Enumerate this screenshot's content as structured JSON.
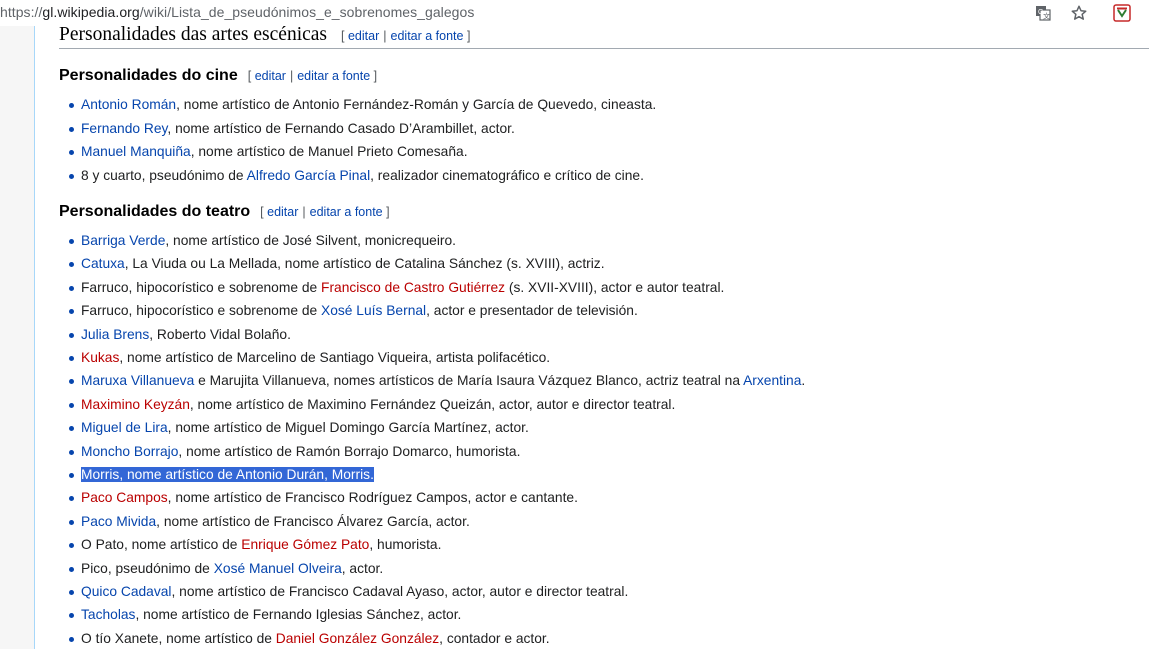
{
  "browser": {
    "url_prefix": "https://",
    "url_host": "gl.wikipedia.org",
    "url_path": "/wiki/Lista_de_pseudónimos_e_sobrenomes_galegos",
    "icons": [
      "translate-icon",
      "star-icon",
      "extension-icon"
    ]
  },
  "edit_labels": {
    "edit": "editar",
    "edit_source": "editar a fonte"
  },
  "heading_top": "Personalidades das artes escénicas",
  "sections": [
    {
      "title": "Personalidades do cine",
      "items": [
        [
          {
            "t": "Antonio Román",
            "c": "blue"
          },
          {
            "t": ", nome artístico de Antonio Fernández-Román y García de Quevedo, cineasta."
          }
        ],
        [
          {
            "t": "Fernando Rey",
            "c": "blue"
          },
          {
            "t": ", nome artístico de Fernando Casado D’Arambillet, actor."
          }
        ],
        [
          {
            "t": "Manuel Manquiña",
            "c": "blue"
          },
          {
            "t": ", nome artístico de Manuel Prieto Comesaña."
          }
        ],
        [
          {
            "t": "8 y cuarto, pseudónimo de "
          },
          {
            "t": "Alfredo García Pinal",
            "c": "blue"
          },
          {
            "t": ", realizador cinematográfico e crítico de cine."
          }
        ]
      ]
    },
    {
      "title": "Personalidades do teatro",
      "items": [
        [
          {
            "t": "Barriga Verde",
            "c": "blue"
          },
          {
            "t": ", nome artístico de José Silvent, monicrequeiro."
          }
        ],
        [
          {
            "t": "Catuxa",
            "c": "blue"
          },
          {
            "t": ", La Viuda ou La Mellada, nome artístico de Catalina Sánchez (s. XVIII), actriz."
          }
        ],
        [
          {
            "t": "Farruco, hipocorístico e sobrenome de "
          },
          {
            "t": "Francisco de Castro Gutiérrez",
            "c": "red"
          },
          {
            "t": " (s. XVII-XVIII), actor e autor teatral."
          }
        ],
        [
          {
            "t": "Farruco, hipocorístico e sobrenome de "
          },
          {
            "t": "Xosé Luís Bernal",
            "c": "blue"
          },
          {
            "t": ", actor e presentador de televisión."
          }
        ],
        [
          {
            "t": "Julia Brens",
            "c": "blue"
          },
          {
            "t": ", Roberto Vidal Bolaño."
          }
        ],
        [
          {
            "t": "Kukas",
            "c": "red"
          },
          {
            "t": ", nome artístico de Marcelino de Santiago Viqueira, artista polifacético."
          }
        ],
        [
          {
            "t": "Maruxa Villanueva",
            "c": "blue"
          },
          {
            "t": " e Marujita Villanueva, nomes artísticos de María Isaura Vázquez Blanco, actriz teatral na "
          },
          {
            "t": "Arxentina",
            "c": "blue"
          },
          {
            "t": "."
          }
        ],
        [
          {
            "t": "Maximino Keyzán",
            "c": "red"
          },
          {
            "t": ", nome artístico de Maximino Fernández Queizán, actor, autor e director teatral."
          }
        ],
        [
          {
            "t": "Miguel de Lira",
            "c": "blue"
          },
          {
            "t": ", nome artístico de Miguel Domingo García Martínez, actor."
          }
        ],
        [
          {
            "t": "Moncho Borrajo",
            "c": "blue"
          },
          {
            "t": ", nome artístico de Ramón Borrajo Domarco, humorista."
          }
        ],
        [
          {
            "t": "Morris, nome artístico de Antonio Durán, Morris.",
            "c": "sel"
          }
        ],
        [
          {
            "t": "Paco Campos",
            "c": "red"
          },
          {
            "t": ", nome artístico de Francisco Rodríguez Campos, actor e cantante."
          }
        ],
        [
          {
            "t": "Paco Mivida",
            "c": "blue"
          },
          {
            "t": ", nome artístico de Francisco Álvarez García, actor."
          }
        ],
        [
          {
            "t": "O Pato, nome artístico de "
          },
          {
            "t": "Enrique Gómez Pato",
            "c": "red"
          },
          {
            "t": ", humorista."
          }
        ],
        [
          {
            "t": "Pico, pseudónimo de "
          },
          {
            "t": "Xosé Manuel Olveira",
            "c": "blue"
          },
          {
            "t": ", actor."
          }
        ],
        [
          {
            "t": "Quico Cadaval",
            "c": "blue"
          },
          {
            "t": ", nome artístico de Francisco Cadaval Ayaso, actor, autor e director teatral."
          }
        ],
        [
          {
            "t": "Tacholas",
            "c": "blue"
          },
          {
            "t": ", nome artístico de Fernando Iglesias Sánchez, actor."
          }
        ],
        [
          {
            "t": "O tío Xanete, nome artístico de "
          },
          {
            "t": "Daniel González González",
            "c": "red"
          },
          {
            "t": ", contador e actor."
          }
        ]
      ]
    }
  ]
}
